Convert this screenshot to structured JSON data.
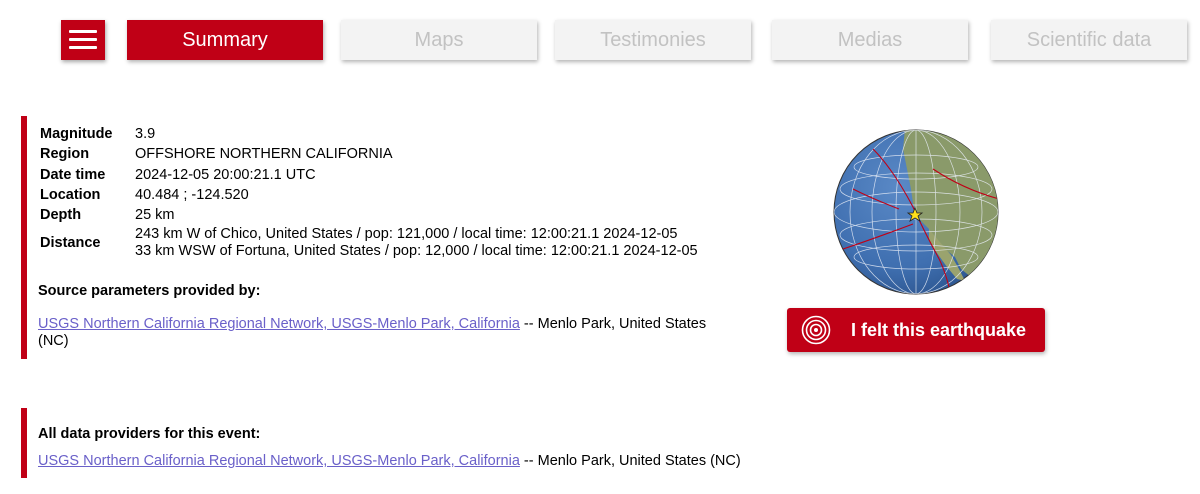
{
  "nav": {
    "menu_icon": "hamburger-menu-icon",
    "tabs": [
      {
        "label": "Summary",
        "active": true
      },
      {
        "label": "Maps",
        "active": false
      },
      {
        "label": "Testimonies",
        "active": false
      },
      {
        "label": "Medias",
        "active": false
      },
      {
        "label": "Scientific data",
        "active": false
      }
    ]
  },
  "event": {
    "magnitude_label": "Magnitude",
    "magnitude": "3.9",
    "region_label": "Region",
    "region": "OFFSHORE NORTHERN CALIFORNIA",
    "datetime_label": "Date time",
    "datetime": "2024-12-05 20:00:21.1 UTC",
    "location_label": "Location",
    "location": "40.484 ; -124.520",
    "depth_label": "Depth",
    "depth": "25 km",
    "distance_label": "Distance",
    "distance": [
      "243 km W of Chico, United States / pop: 121,000 / local time: 12:00:21.1 2024-12-05",
      "33 km WSW of Fortuna, United States / pop: 12,000 / local time: 12:00:21.1 2024-12-05"
    ]
  },
  "source": {
    "title": "Source parameters provided by:",
    "link": "USGS Northern California Regional Network, USGS-Menlo Park, California",
    "suffix": " -- Menlo Park, United States (NC)"
  },
  "providers": {
    "title": "All data providers for this event:",
    "link": "USGS Northern California Regional Network, USGS-Menlo Park, California",
    "suffix": " -- Menlo Park, United States (NC)"
  },
  "felt_button": {
    "label": "I felt this earthquake",
    "icon": "concentric-circles-icon"
  },
  "globe": {
    "icon": "globe-map-icon",
    "marker": "epicenter-star-icon",
    "ocean_color": "#3f6fb0",
    "land_color": "#8a9a6a",
    "plate_boundary_color": "#c00016"
  },
  "colors": {
    "accent": "#c00016",
    "tab_inactive_bg": "#f3f3f3",
    "tab_inactive_text": "#c2c2c2",
    "link": "#6a60c9"
  }
}
